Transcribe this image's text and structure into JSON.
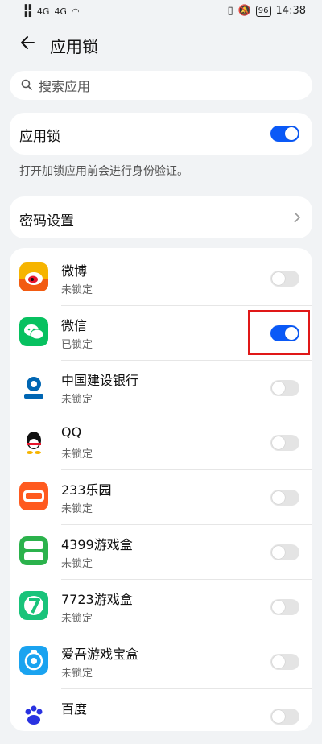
{
  "status_bar": {
    "left": [
      "HD",
      "4G",
      "4G"
    ],
    "battery": "96",
    "time": "14:38"
  },
  "header": {
    "title": "应用锁"
  },
  "search": {
    "placeholder": "搜索应用"
  },
  "app_lock": {
    "label": "应用锁",
    "enabled": true
  },
  "note": "打开加锁应用前会进行身份验证。",
  "password": {
    "label": "密码设置"
  },
  "apps": [
    {
      "name": "微博",
      "status": "未锁定",
      "locked": false,
      "icon": "weibo-icon"
    },
    {
      "name": "微信",
      "status": "已锁定",
      "locked": true,
      "icon": "wechat-icon"
    },
    {
      "name": "中国建设银行",
      "status": "未锁定",
      "locked": false,
      "icon": "ccb-icon"
    },
    {
      "name": "QQ",
      "status": "未锁定",
      "locked": false,
      "icon": "qq-icon"
    },
    {
      "name": "233乐园",
      "status": "未锁定",
      "locked": false,
      "icon": "233-icon"
    },
    {
      "name": "4399游戏盒",
      "status": "未锁定",
      "locked": false,
      "icon": "4399-icon"
    },
    {
      "name": "7723游戏盒",
      "status": "未锁定",
      "locked": false,
      "icon": "7723-icon"
    },
    {
      "name": "爱吾游戏宝盒",
      "status": "未锁定",
      "locked": false,
      "icon": "aiwu-icon"
    },
    {
      "name": "百度",
      "status": "",
      "locked": false,
      "icon": "baidu-icon"
    }
  ],
  "colors": {
    "accent": "#0a59f7",
    "highlight": "#e01818",
    "background": "#f1f3f5"
  }
}
